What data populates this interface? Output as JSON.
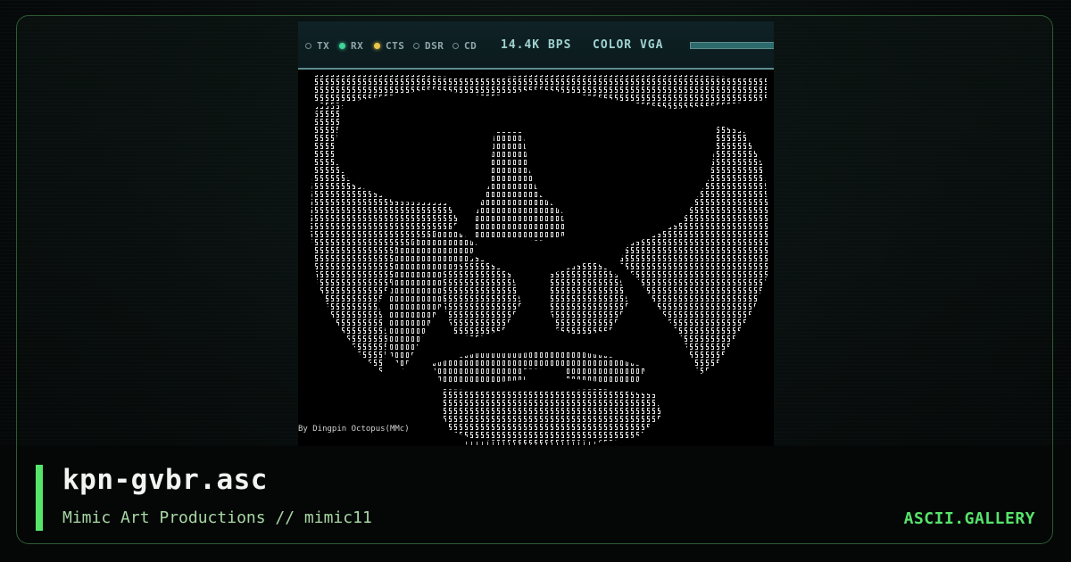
{
  "terminal": {
    "indicators": [
      {
        "label": "TX",
        "state": "off"
      },
      {
        "label": "RX",
        "state": "green"
      },
      {
        "label": "CTS",
        "state": "amber"
      },
      {
        "label": "DSR",
        "state": "off"
      },
      {
        "label": "CD",
        "state": "off"
      }
    ],
    "baud": "14.4K BPS",
    "mode": "COLOR VGA",
    "signature": "By Dingpin Octopus(MMc)"
  },
  "artwork": {
    "fg_color": "#e6e6e6",
    "bg_color": "#000000",
    "subject": "ascii-portrait-face"
  },
  "footer": {
    "filename": "kpn-gvbr.asc",
    "credit": "Mimic Art Productions // mimic11",
    "brand": "ASCII.GALLERY"
  },
  "colors": {
    "accent": "#57e46b",
    "frame": "#2c5b34",
    "credit": "#a7d7a3"
  }
}
